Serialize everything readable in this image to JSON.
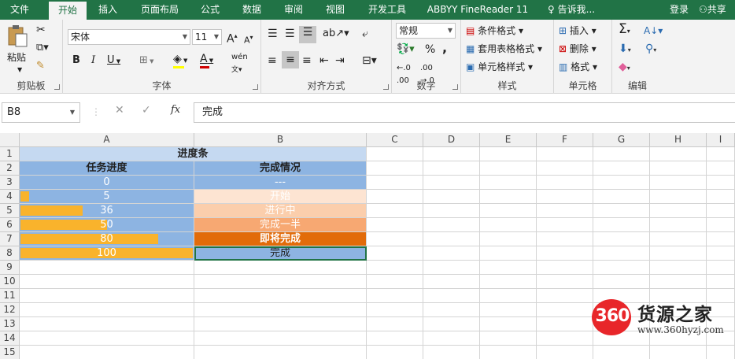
{
  "tabs": [
    {
      "label": "文件",
      "active": false
    },
    {
      "label": "开始",
      "active": true
    },
    {
      "label": "插入",
      "active": false
    },
    {
      "label": "页面布局",
      "active": false
    },
    {
      "label": "公式",
      "active": false
    },
    {
      "label": "数据",
      "active": false
    },
    {
      "label": "审阅",
      "active": false
    },
    {
      "label": "视图",
      "active": false
    },
    {
      "label": "开发工具",
      "active": false
    },
    {
      "label": "ABBYY FineReader 11",
      "active": false
    }
  ],
  "tell_me": "告诉我...",
  "login": "登录",
  "share": "共享",
  "ribbon": {
    "clipboard": {
      "label": "剪贴板",
      "paste": "粘贴"
    },
    "font": {
      "label": "字体",
      "font_name": "宋体",
      "font_size": "11",
      "bold": "B",
      "italic": "I",
      "underline": "U",
      "grow": "A",
      "shrink": "A",
      "font_color_letter": "A",
      "phonetic": "wén"
    },
    "alignment": {
      "label": "对齐方式"
    },
    "number": {
      "label": "数字",
      "format": "常规",
      "percent": "%",
      "comma": ","
    },
    "styles": {
      "label": "样式",
      "conditional": "条件格式",
      "table_format": "套用表格格式",
      "cell_styles": "单元格样式"
    },
    "cells": {
      "label": "单元格",
      "insert": "插入",
      "delete": "删除",
      "format": "格式"
    },
    "editing": {
      "label": "编辑"
    }
  },
  "name_box": "B8",
  "formula": "完成",
  "fx": "fx",
  "columns": [
    "A",
    "B",
    "C",
    "D",
    "E",
    "F",
    "G",
    "H",
    "I"
  ],
  "rows": [
    "1",
    "2",
    "3",
    "4",
    "5",
    "6",
    "7",
    "8",
    "9",
    "10",
    "11",
    "12",
    "13",
    "14",
    "15"
  ],
  "sheet": {
    "title": "进度条",
    "header_a": "任务进度",
    "header_b": "完成情况",
    "data": [
      {
        "progress": "0",
        "status": "---",
        "status_color": "#8db4e2"
      },
      {
        "progress": "5",
        "status": "开始",
        "status_color": "#fde4d2"
      },
      {
        "progress": "36",
        "status": "进行中",
        "status_color": "#fbceac"
      },
      {
        "progress": "50",
        "status": "完成一半",
        "status_color": "#f7a872"
      },
      {
        "progress": "80",
        "status": "即将完成",
        "status_color": "#e26b0a"
      },
      {
        "progress": "100",
        "status": "完成",
        "status_color": "#8db4e2"
      }
    ]
  },
  "colors": {
    "accent": "#217346",
    "header_fill": "#8db4e2",
    "title_fill": "#c5d9f1",
    "bar": "#f9b32c"
  },
  "watermark": {
    "logo": "360",
    "brand": "货源之家",
    "url": "www.360hyzj.com"
  }
}
